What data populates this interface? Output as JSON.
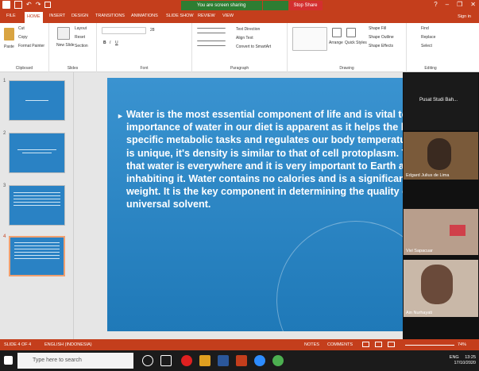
{
  "titlebar": {
    "sharing_msg": "You are screen sharing",
    "stop_share": "Stop Share",
    "help": "?",
    "min": "–",
    "restore": "❐",
    "close": "✕"
  },
  "tabs": [
    "FILE",
    "HOME",
    "INSERT",
    "DESIGN",
    "TRANSITIONS",
    "ANIMATIONS",
    "SLIDE SHOW",
    "REVIEW",
    "VIEW"
  ],
  "signin": "Sign in",
  "ribbon": {
    "clipboard": {
      "paste": "Paste",
      "cut": "Cut",
      "copy": "Copy",
      "format_painter": "Format Painter",
      "label": "Clipboard"
    },
    "slides": {
      "new_slide": "New Slide",
      "layout": "Layout",
      "reset": "Reset",
      "section": "Section",
      "label": "Slides"
    },
    "font": {
      "label": "Font",
      "size": "28"
    },
    "paragraph": {
      "text_direction": "Text Direction",
      "align_text": "Align Text",
      "smartart": "Convert to SmartArt",
      "label": "Paragraph"
    },
    "drawing": {
      "arrange": "Arrange",
      "quick_styles": "Quick Styles",
      "fill": "Shape Fill",
      "outline": "Shape Outline",
      "effects": "Shape Effects",
      "label": "Drawing"
    },
    "editing": {
      "find": "Find",
      "replace": "Replace",
      "select": "Select",
      "label": "Editing"
    }
  },
  "slides": [
    "1",
    "2",
    "3",
    "4"
  ],
  "slide_text": "Water is the most essential component of life and is vital to sustenance. The importance of water in our diet is apparent as it helps the body to perform specific metabolic tasks and regulates our body temperature, moreover water is unique, it's density is similar to that of cell protoplasm. There is no doubt that water is everywhere and it is very important to Earth and the life inhabiting it. Water contains no calories and is a significant factor in losing weight. It is the key component in determining the quality of our lives and is a universal solvent.",
  "participants": [
    "Pusat Studi Bah...",
    "Edgard Julius de Lima",
    "Vivi Sapacuar",
    "Ain Nurhayati"
  ],
  "status": {
    "slide": "SLIDE 4 OF 4",
    "language": "ENGLISH (INDONESIA)",
    "notes": "NOTES",
    "comments": "COMMENTS",
    "zoom": "74%"
  },
  "taskbar": {
    "search_placeholder": "Type here to search",
    "lang": "ENG",
    "time": "13:25",
    "date": "17/10/2020"
  },
  "colors": {
    "accent": "#c43e1c",
    "slide_bg": "#2a82c4"
  }
}
